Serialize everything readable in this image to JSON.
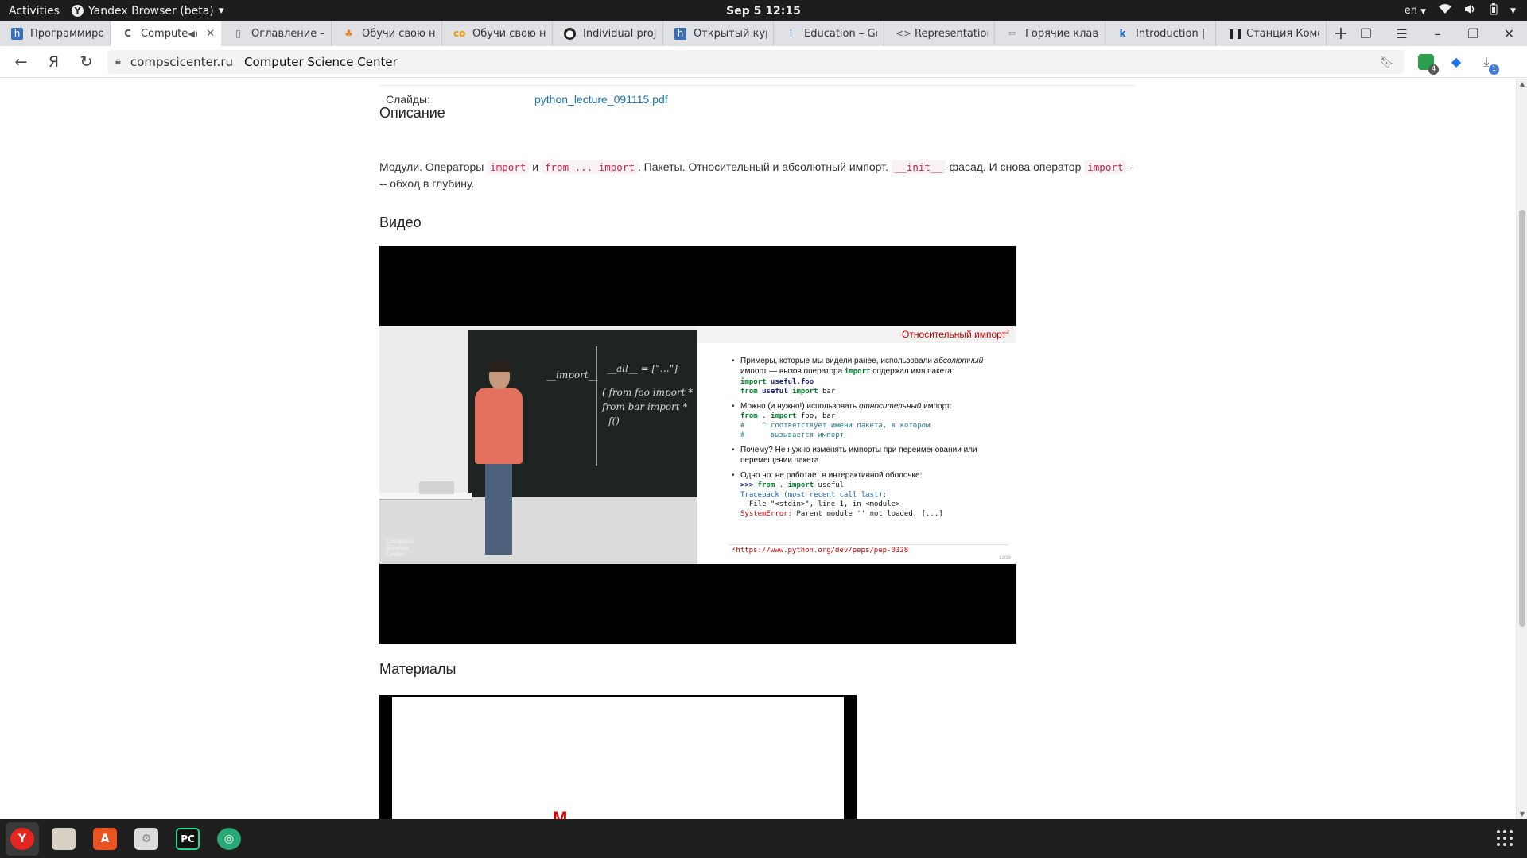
{
  "system": {
    "activities": "Activities",
    "app_name": "Yandex Browser (beta)",
    "clock": "Sep 5  12:15",
    "language": "en"
  },
  "tabs": [
    {
      "title": "Программиро",
      "favicon": "h-icon",
      "color": "#3c6fb6"
    },
    {
      "title": "Compute",
      "favicon": "csc-icon",
      "color": "#555555",
      "active": true
    },
    {
      "title": "Оглавление —",
      "favicon": "document-icon",
      "color": "#777777"
    },
    {
      "title": "Обучи свою не",
      "favicon": "pumpkin-icon",
      "color": "#e8861e"
    },
    {
      "title": "Обучи свою не",
      "favicon": "colab-icon",
      "color": "#f29900"
    },
    {
      "title": "Individual proje",
      "favicon": "github-icon",
      "color": "#222222"
    },
    {
      "title": "Открытый кур",
      "favicon": "h-icon",
      "color": "#3c6fb6"
    },
    {
      "title": "Education – Goo",
      "favicon": "google-dots-icon",
      "color": "#4285f4"
    },
    {
      "title": "Representation",
      "favicon": "code-icon",
      "color": "#555555"
    },
    {
      "title": "Горячие клави",
      "favicon": "keyboard-icon",
      "color": "#777777"
    },
    {
      "title": "Introduction | K",
      "favicon": "k-icon",
      "color": "#1565c0"
    },
    {
      "title": "Станция Комо",
      "favicon": "pause-icon",
      "color": "#222222"
    }
  ],
  "toolbar": {
    "domain": "compscicenter.ru",
    "page_title": "Computer Science Center",
    "ext_badge_1": "4",
    "download_badge": "1"
  },
  "page": {
    "slides_label": "Слайды:",
    "slides_link": "python_lecture_091115.pdf",
    "description_heading": "Описание",
    "desc_t1": "Модули. Операторы ",
    "desc_c1": "import",
    "desc_t2": " и ",
    "desc_c2": "from ... import",
    "desc_t3": ". Пакеты. Относительный и абсолютный импорт. ",
    "desc_c3": "__init__",
    "desc_t4": "-фасад. И снова оператор ",
    "desc_c4": "import",
    "desc_t5": " --- обход в глубину.",
    "video_heading": "Видео",
    "materials_heading": "Материалы"
  },
  "video": {
    "slide_title": "Относительный импорт",
    "slide_title_sup": "2",
    "b1_t1": "Примеры, которые мы видели ранее, использовали ",
    "b1_em": "абсолютный",
    "b1_t2": " импорт — вызов оператора ",
    "b1_kw": "import",
    "b1_t3": " содержал имя пакета:",
    "b1_code1_kw": "import",
    "b1_code1": " useful.foo",
    "b1_code2_kw1": "from",
    "b1_code2_mod": " useful ",
    "b1_code2_kw2": "import",
    "b1_code2_rest": " bar",
    "b2_t1": "Можно (и нужно!) использовать ",
    "b2_em": "относительный",
    "b2_t2": " импорт:",
    "b2_code_kw1": "from",
    "b2_code_mid": " . ",
    "b2_code_kw2": "import",
    "b2_code_rest": " foo, bar",
    "b2_comment1": "#    ^ соответствует имени пакета, в котором",
    "b2_comment2": "#      вызывается импорт",
    "b3_text": "Почему? Не нужно изменять импорты при переименовании или перемещении пакета.",
    "b4_text": "Одно но: не работает в интерактивной оболочке:",
    "b4_prompt": ">>>",
    "b4_kw1": " from",
    "b4_mid": " . ",
    "b4_kw2": "import",
    "b4_rest": " useful",
    "b4_tb": "Traceback (most recent call last):",
    "b4_file": "  File \"<stdin>\", line 1, in <module>",
    "b4_err": "SystemError:",
    "b4_err_rest": " Parent module '' not loaded, [...]",
    "footnote": "²https://www.python.org/dev/peps/pep-0328",
    "page_number": "12/38",
    "chalk1": "__import__",
    "chalk2": "__all__ = [\"…\"]",
    "chalk3": "( from foo import *",
    "chalk4": "  from bar import *",
    "chalk5": "  f()",
    "watermark": "Computer\nScience\nCenter"
  },
  "dock": [
    {
      "name": "yandex-browser",
      "label": "Y",
      "color": "#e52620"
    },
    {
      "name": "files",
      "label": "",
      "color": "#d6d1c4"
    },
    {
      "name": "software-center",
      "label": "A",
      "color": "#e95420"
    },
    {
      "name": "settings",
      "label": "",
      "color": "#dcdcdc"
    },
    {
      "name": "pycharm",
      "label": "PC",
      "color": "#21d789"
    },
    {
      "name": "network-app",
      "label": "",
      "color": "#2aa876"
    }
  ]
}
